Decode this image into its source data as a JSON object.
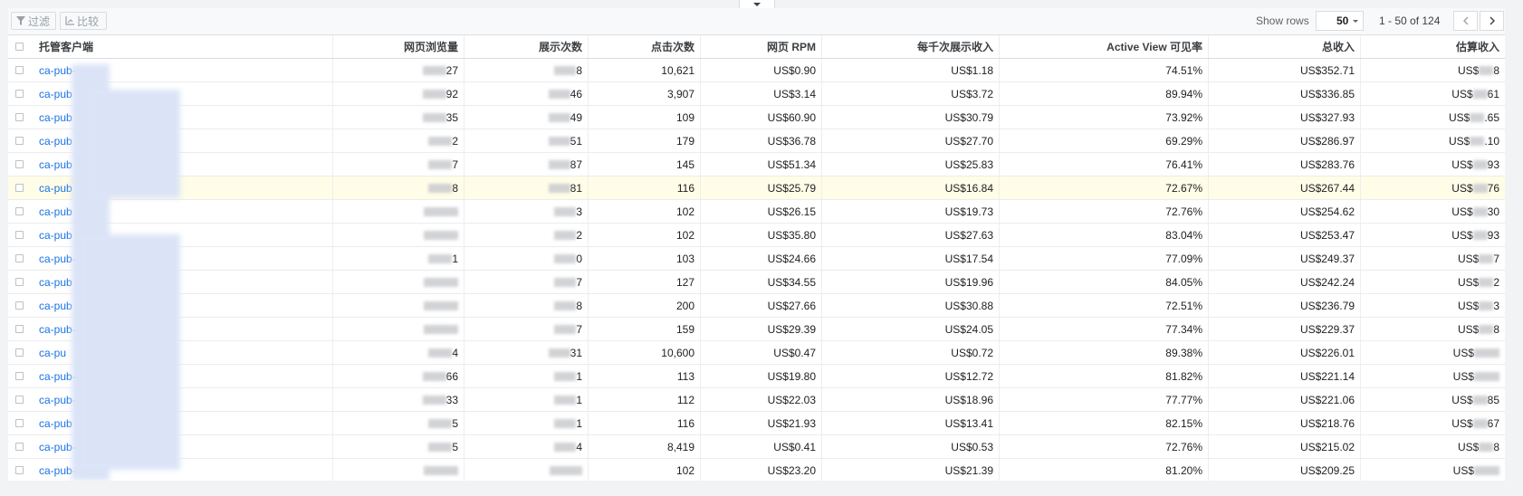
{
  "toolbar": {
    "filter_label": "过滤",
    "compare_label": "比较",
    "show_rows_label": "Show rows",
    "rows_value": "50",
    "range_text": "1 - 50 of 124",
    "filter_icon": "filter-icon",
    "compare_icon": "compare-icon"
  },
  "columns": [
    "托管客户端",
    "网页浏览量",
    "展示次数",
    "点击次数",
    "网页 RPM",
    "每千次展示收入",
    "Active View 可见率",
    "总收入",
    "估算收入"
  ],
  "rows": [
    {
      "client": "ca-pub-",
      "views": "27",
      "impr": "8",
      "clicks": "10,621",
      "rpm": "US$0.90",
      "ecpm": "US$1.18",
      "av": "74.51%",
      "total": "US$352.71",
      "est": "8"
    },
    {
      "client": "ca-pub",
      "views": "92",
      "impr": "46",
      "clicks": "3,907",
      "rpm": "US$3.14",
      "ecpm": "US$3.72",
      "av": "89.94%",
      "total": "US$336.85",
      "est": "61"
    },
    {
      "client": "ca-pub",
      "views": "35",
      "impr": "49",
      "clicks": "109",
      "rpm": "US$60.90",
      "ecpm": "US$30.79",
      "av": "73.92%",
      "total": "US$327.93",
      "est": ".65"
    },
    {
      "client": "ca-pub",
      "views": "2",
      "impr": "51",
      "clicks": "179",
      "rpm": "US$36.78",
      "ecpm": "US$27.70",
      "av": "69.29%",
      "total": "US$286.97",
      "est": ".10"
    },
    {
      "client": "ca-pub",
      "views": "7",
      "impr": "87",
      "clicks": "145",
      "rpm": "US$51.34",
      "ecpm": "US$25.83",
      "av": "76.41%",
      "total": "US$283.76",
      "est": "93"
    },
    {
      "client": "ca-pub",
      "views": "8",
      "impr": "81",
      "clicks": "116",
      "rpm": "US$25.79",
      "ecpm": "US$16.84",
      "av": "72.67%",
      "total": "US$267.44",
      "est": "76"
    },
    {
      "client": "ca-pub",
      "views": "",
      "impr": "3",
      "clicks": "102",
      "rpm": "US$26.15",
      "ecpm": "US$19.73",
      "av": "72.76%",
      "total": "US$254.62",
      "est": "30"
    },
    {
      "client": "ca-pub",
      "views": "",
      "impr": "2",
      "clicks": "102",
      "rpm": "US$35.80",
      "ecpm": "US$27.63",
      "av": "83.04%",
      "total": "US$253.47",
      "est": "93"
    },
    {
      "client": "ca-pub-",
      "views": "1",
      "impr": "0",
      "clicks": "103",
      "rpm": "US$24.66",
      "ecpm": "US$17.54",
      "av": "77.09%",
      "total": "US$249.37",
      "est": "7"
    },
    {
      "client": "ca-pub",
      "views": "",
      "impr": "7",
      "clicks": "127",
      "rpm": "US$34.55",
      "ecpm": "US$19.96",
      "av": "84.05%",
      "total": "US$242.24",
      "est": "2"
    },
    {
      "client": "ca-pub",
      "views": "",
      "impr": "8",
      "clicks": "200",
      "rpm": "US$27.66",
      "ecpm": "US$30.88",
      "av": "72.51%",
      "total": "US$236.79",
      "est": "3"
    },
    {
      "client": "ca-pub-",
      "views": "",
      "impr": "7",
      "clicks": "159",
      "rpm": "US$29.39",
      "ecpm": "US$24.05",
      "av": "77.34%",
      "total": "US$229.37",
      "est": "8"
    },
    {
      "client": "ca-pu",
      "views": "4",
      "impr": "31",
      "clicks": "10,600",
      "rpm": "US$0.47",
      "ecpm": "US$0.72",
      "av": "89.38%",
      "total": "US$226.01",
      "est": ""
    },
    {
      "client": "ca-pub-",
      "views": "66",
      "impr": "1",
      "clicks": "113",
      "rpm": "US$19.80",
      "ecpm": "US$12.72",
      "av": "81.82%",
      "total": "US$221.14",
      "est": ""
    },
    {
      "client": "ca-pub-",
      "views": "33",
      "impr": "1",
      "clicks": "112",
      "rpm": "US$22.03",
      "ecpm": "US$18.96",
      "av": "77.77%",
      "total": "US$221.06",
      "est": "85"
    },
    {
      "client": "ca-pub",
      "views": "5",
      "impr": "1",
      "clicks": "116",
      "rpm": "US$21.93",
      "ecpm": "US$13.41",
      "av": "82.15%",
      "total": "US$218.76",
      "est": "67"
    },
    {
      "client": "ca-pub-",
      "views": "5",
      "impr": "4",
      "clicks": "8,419",
      "rpm": "US$0.41",
      "ecpm": "US$0.53",
      "av": "72.76%",
      "total": "US$215.02",
      "est": "8"
    },
    {
      "client": "ca-pub-",
      "views": "",
      "impr": "",
      "clicks": "102",
      "rpm": "US$23.20",
      "ecpm": "US$21.39",
      "av": "81.20%",
      "total": "US$209.25",
      "est": ""
    }
  ],
  "highlight_row": 5,
  "colors": {
    "link": "#1a73e8",
    "highlight": "#fffde7",
    "redaction": "#dbe4f7"
  }
}
